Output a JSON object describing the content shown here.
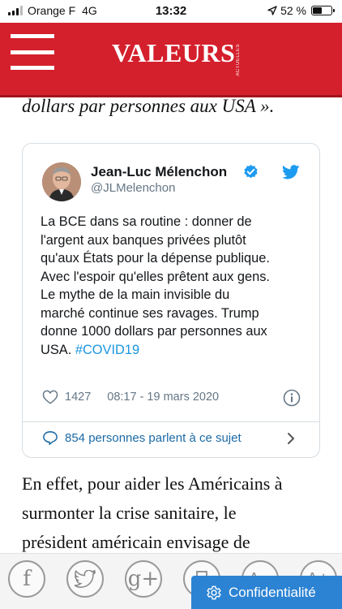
{
  "status_bar": {
    "carrier": "Orange F",
    "network": "4G",
    "time": "13:32",
    "battery": "52 %",
    "battery_level": 0.52
  },
  "header": {
    "logo": "VALEURS",
    "logo_sub": "ACTUELLES",
    "brand_color": "#d4202c",
    "menu_icon": "hamburger-icon"
  },
  "article": {
    "lead_in": "dollars par personnes aux USA ».",
    "continuation": [
      "En effet, pour aider les Américains à",
      "surmonter la crise sanitaire, le",
      "président américain envisage de"
    ]
  },
  "tweet": {
    "author": "Jean-Luc Mélenchon",
    "handle": "@JLMelenchon",
    "text_lines": [
      "La BCE dans sa routine : donner de",
      "l'argent aux banques privées plutôt",
      "qu'aux États pour la dépense publique.",
      "Avec l'espoir qu'elles prêtent aux gens.",
      "Le mythe de la main invisible du",
      "marché continue ses ravages. Trump",
      "donne 1000 dollars par personnes aux"
    ],
    "last_line_prefix": "USA.",
    "hashtag": "#COVID19",
    "likes": "1427",
    "timestamp": "08:17 - 19 mars 2020",
    "conversation": "854 personnes parlent à ce sujet",
    "link_color": "#1b95e0"
  },
  "share_bar": {
    "buttons": [
      {
        "name": "facebook-icon",
        "glyph": "f"
      },
      {
        "name": "twitter-icon",
        "glyph": ""
      },
      {
        "name": "google-plus-icon",
        "glyph": "g+"
      },
      {
        "name": "print-icon",
        "glyph": ""
      },
      {
        "name": "font-decrease-icon",
        "glyph": "A−"
      },
      {
        "name": "font-increase-icon",
        "glyph": "A+"
      }
    ]
  },
  "consent": {
    "label": "Confidentialité",
    "icon": "gear-icon",
    "color": "#2c83d3"
  }
}
